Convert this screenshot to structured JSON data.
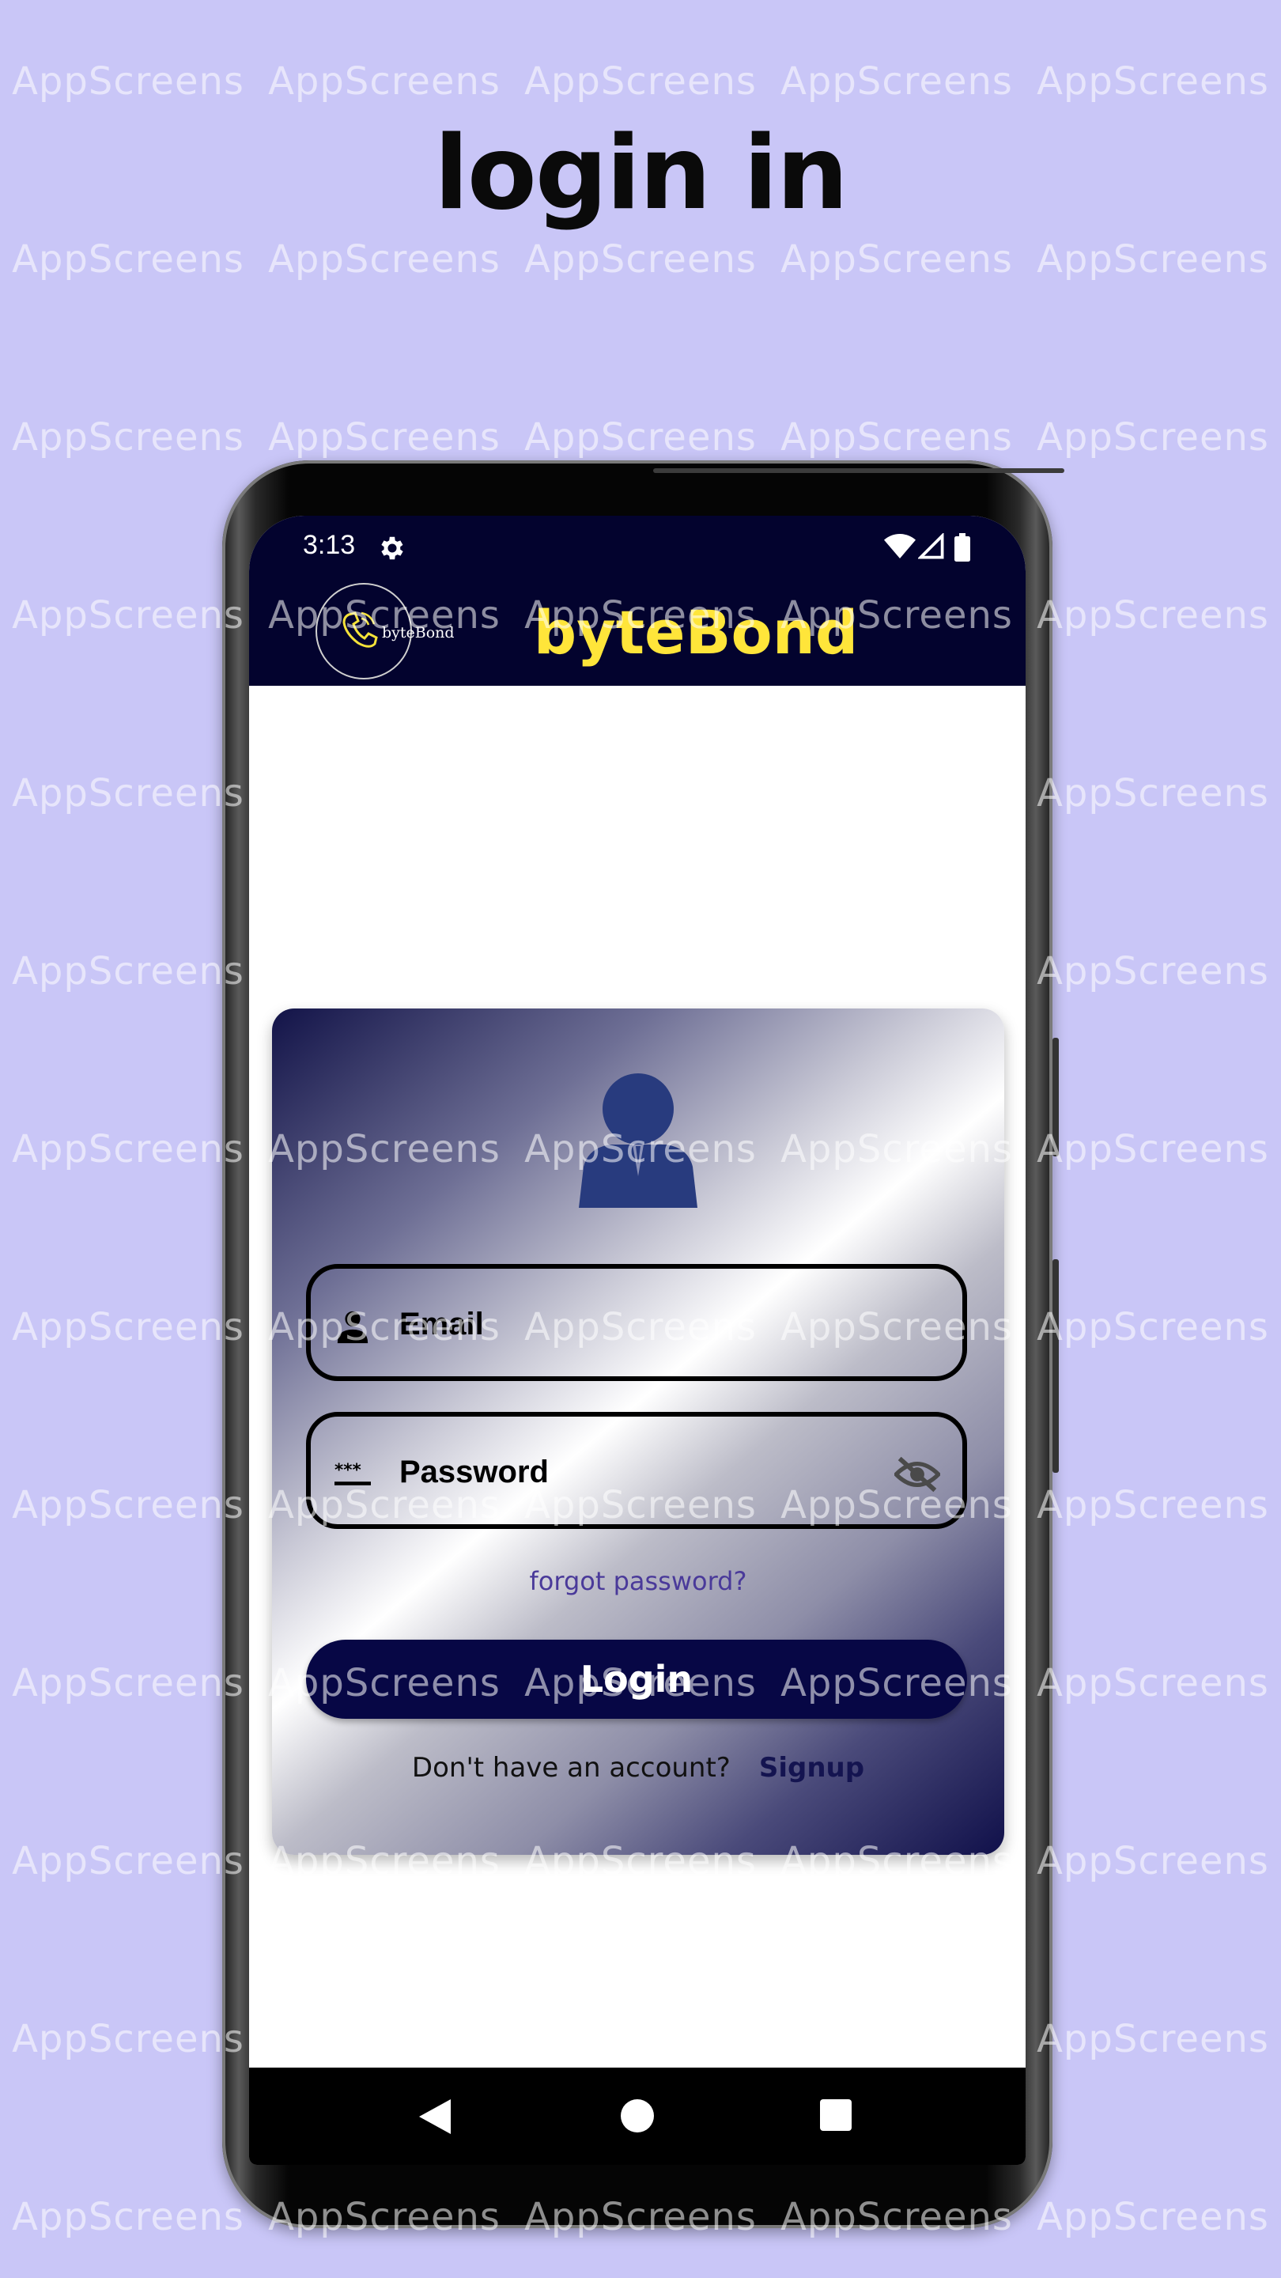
{
  "headline": "login in",
  "watermark": {
    "text": "AppScreens"
  },
  "status_bar": {
    "time": "3:13",
    "icons": [
      "settings-icon",
      "wifi-icon",
      "signal-icon",
      "battery-icon"
    ]
  },
  "app_bar": {
    "logo_text": "byteBond",
    "title": "byteBond"
  },
  "login_form": {
    "avatar_icon": "person-icon",
    "email_label": "Email",
    "password_label": "Password",
    "forgot_password": "forgot password?",
    "login_button": "Login",
    "signup_prompt": "Don't have an account?",
    "signup_link": "Signup"
  },
  "nav_bar": {
    "buttons": [
      "back-icon",
      "home-icon",
      "recents-icon"
    ]
  },
  "colors": {
    "background": "#c9c6f7",
    "app_bar": "#03032e",
    "title_yellow": "#ffe53a",
    "button": "#070745",
    "link": "#4a3a9a"
  }
}
